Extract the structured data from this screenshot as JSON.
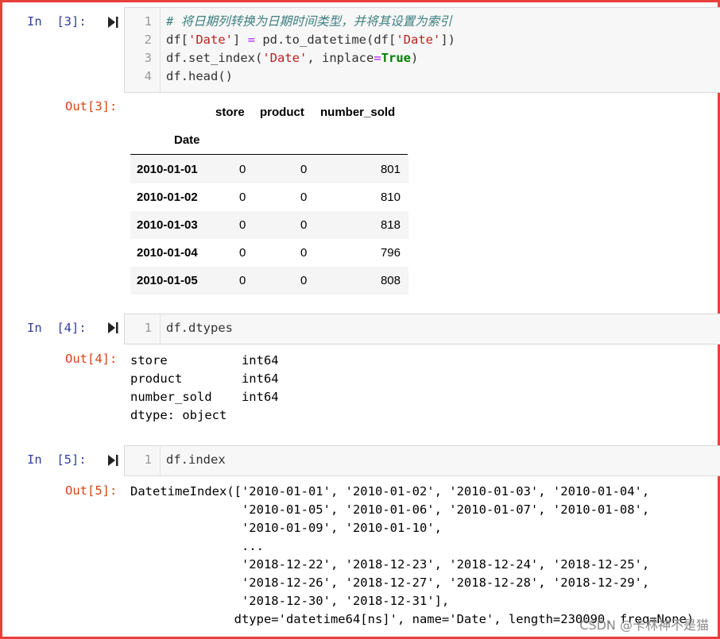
{
  "cell3": {
    "in_prompt": "In  [3]:",
    "out_prompt": "Out[3]:",
    "lines": [
      {
        "num": "1",
        "tokens": [
          {
            "t": "# 将日期列转换为日期时间类型，并将其设置为索引",
            "c": "cm-comment"
          }
        ]
      },
      {
        "num": "2",
        "tokens": [
          {
            "t": "df[",
            "c": ""
          },
          {
            "t": "'Date'",
            "c": "cm-str"
          },
          {
            "t": "] ",
            "c": ""
          },
          {
            "t": "=",
            "c": "cm-op"
          },
          {
            "t": " pd.to_datetime(df[",
            "c": ""
          },
          {
            "t": "'Date'",
            "c": "cm-str"
          },
          {
            "t": "])",
            "c": ""
          }
        ]
      },
      {
        "num": "3",
        "tokens": [
          {
            "t": "df.set_index(",
            "c": ""
          },
          {
            "t": "'Date'",
            "c": "cm-str"
          },
          {
            "t": ", inplace",
            "c": ""
          },
          {
            "t": "=",
            "c": "cm-op"
          },
          {
            "t": "True",
            "c": "cm-kw"
          },
          {
            "t": ")",
            "c": ""
          }
        ]
      },
      {
        "num": "4",
        "tokens": [
          {
            "t": "df.head()",
            "c": ""
          }
        ]
      }
    ],
    "table": {
      "columns": [
        "store",
        "product",
        "number_sold"
      ],
      "index_name": "Date",
      "rows": [
        {
          "date": "2010-01-01",
          "store": "0",
          "product": "0",
          "number_sold": "801"
        },
        {
          "date": "2010-01-02",
          "store": "0",
          "product": "0",
          "number_sold": "810"
        },
        {
          "date": "2010-01-03",
          "store": "0",
          "product": "0",
          "number_sold": "818"
        },
        {
          "date": "2010-01-04",
          "store": "0",
          "product": "0",
          "number_sold": "796"
        },
        {
          "date": "2010-01-05",
          "store": "0",
          "product": "0",
          "number_sold": "808"
        }
      ]
    }
  },
  "cell4": {
    "in_prompt": "In  [4]:",
    "out_prompt": "Out[4]:",
    "lines": [
      {
        "num": "1",
        "tokens": [
          {
            "t": "df.dtypes",
            "c": ""
          }
        ]
      }
    ],
    "output_lines": [
      "store          int64",
      "product        int64",
      "number_sold    int64",
      "dtype: object"
    ]
  },
  "cell5": {
    "in_prompt": "In  [5]:",
    "out_prompt": "Out[5]:",
    "lines": [
      {
        "num": "1",
        "tokens": [
          {
            "t": "df.index",
            "c": ""
          }
        ]
      }
    ],
    "output_lines": [
      "DatetimeIndex(['2010-01-01', '2010-01-02', '2010-01-03', '2010-01-04',",
      "               '2010-01-05', '2010-01-06', '2010-01-07', '2010-01-08',",
      "               '2010-01-09', '2010-01-10',",
      "               ...",
      "               '2018-12-22', '2018-12-23', '2018-12-24', '2018-12-25',",
      "               '2018-12-26', '2018-12-27', '2018-12-28', '2018-12-29',",
      "               '2018-12-30', '2018-12-31'],",
      "              dtype='datetime64[ns]', name='Date', length=230090, freq=None)"
    ]
  },
  "watermark": "CSDN @卡林神不是猫",
  "colors": {
    "frame": "#e8413c",
    "in_prompt": "#303f9f",
    "out_prompt": "#d84315",
    "input_bg": "#f7f7f7"
  },
  "icons": {
    "run": "run-cell-icon"
  }
}
